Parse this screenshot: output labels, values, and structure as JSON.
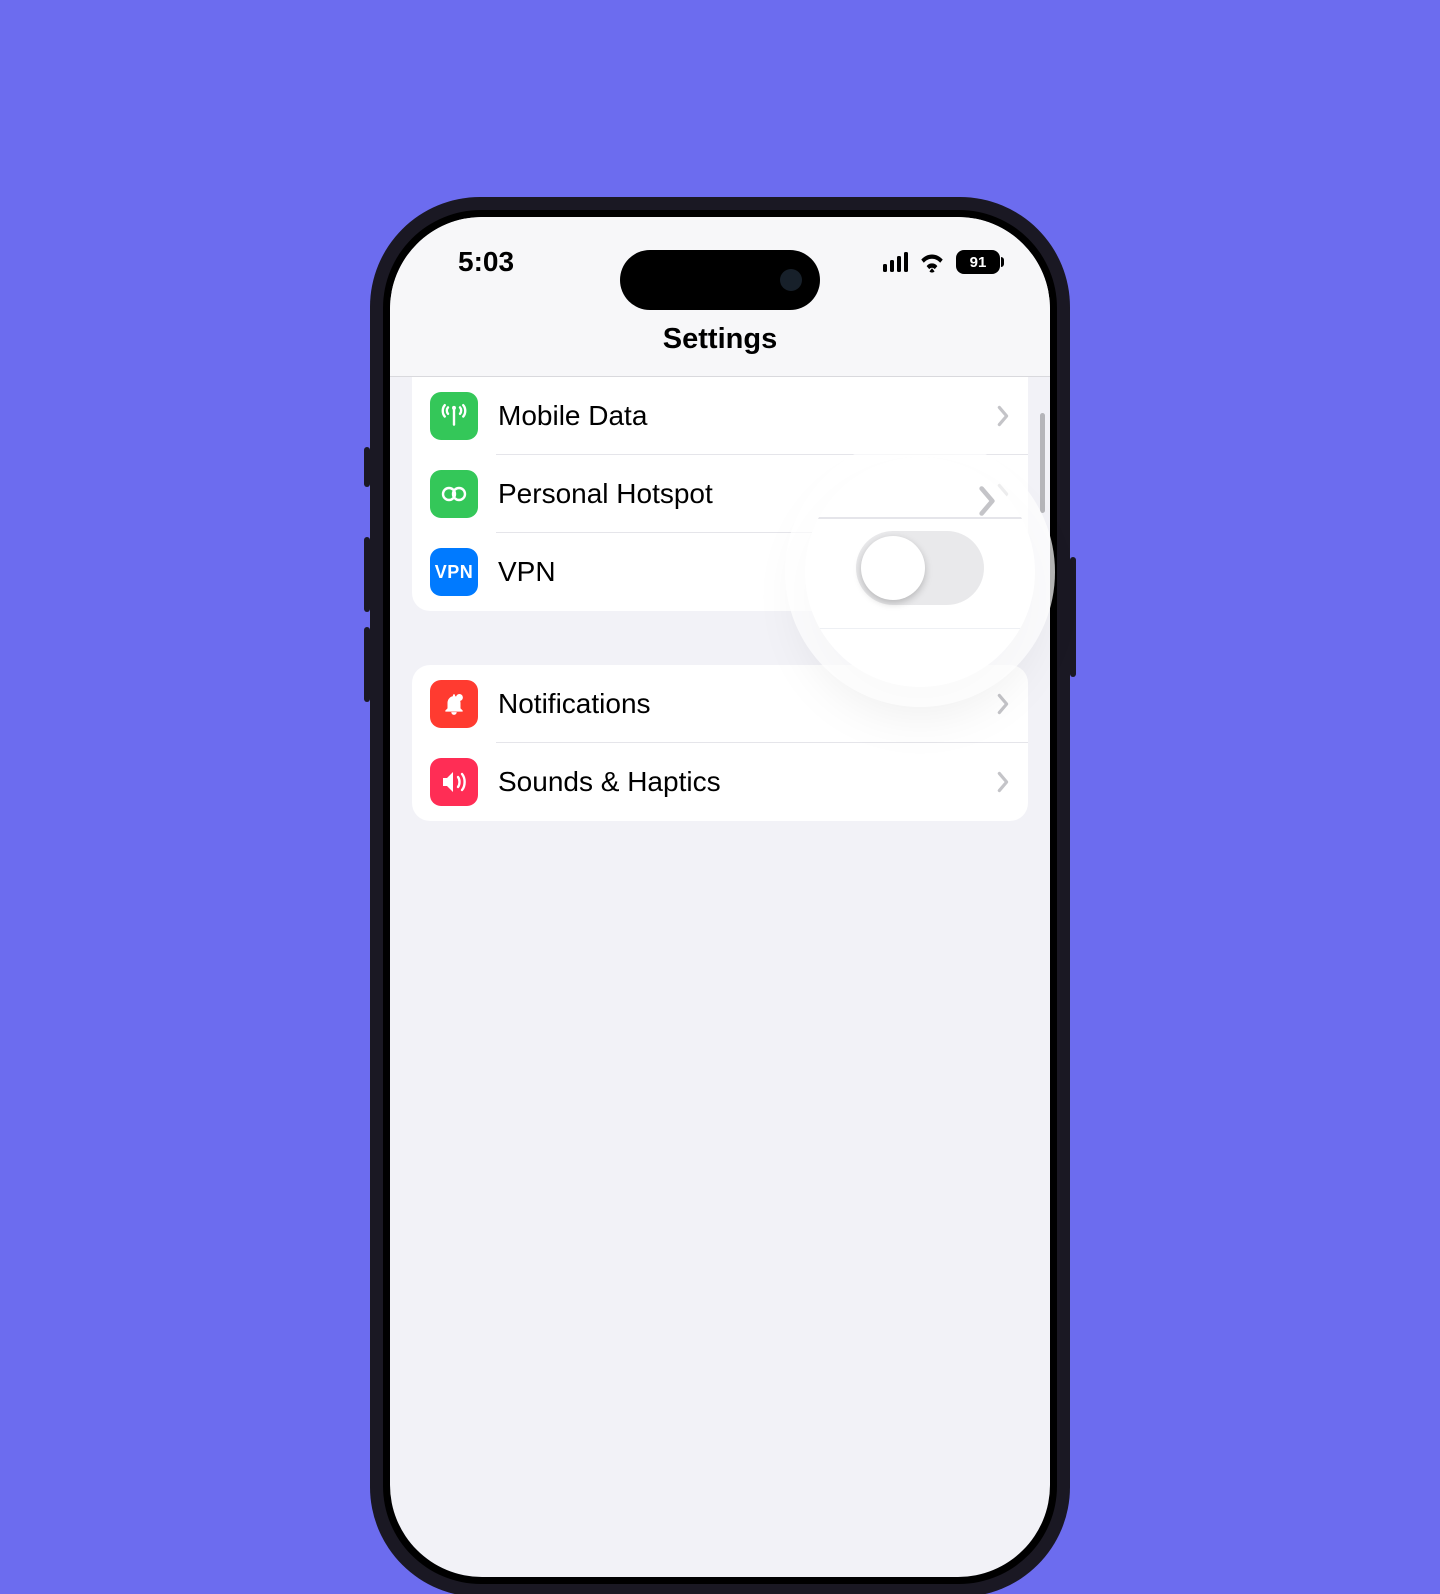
{
  "statusbar": {
    "time": "5:03",
    "battery": "91"
  },
  "page": {
    "title": "Settings"
  },
  "group1": {
    "items": [
      {
        "label": "Mobile Data",
        "icon": "mobile-data-icon",
        "tail": "chevron"
      },
      {
        "label": "Personal Hotspot",
        "icon": "hotspot-icon",
        "tail": "chevron"
      },
      {
        "label": "VPN",
        "icon": "vpn-icon",
        "iconText": "VPN",
        "tail": "toggle"
      }
    ]
  },
  "group2": {
    "items": [
      {
        "label": "Notifications",
        "icon": "notifications-icon",
        "tail": "chevron"
      },
      {
        "label": "Sounds & Haptics",
        "icon": "sounds-icon",
        "tail": "chevron"
      }
    ]
  }
}
